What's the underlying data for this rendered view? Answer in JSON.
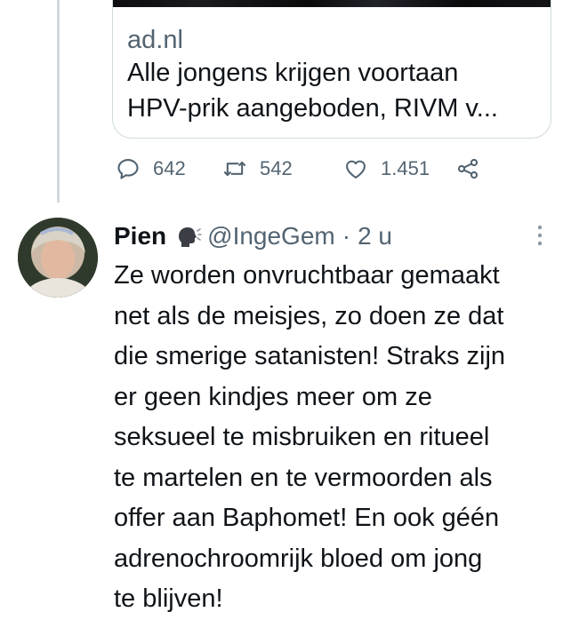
{
  "link_card": {
    "domain": "ad.nl",
    "title_lines": [
      "Alle jongens krijgen voortaan",
      "HPV-prik aangeboden, RIVM v..."
    ]
  },
  "actions": {
    "reply": {
      "icon": "reply-bubble-icon",
      "count": "642"
    },
    "retweet": {
      "icon": "retweet-icon",
      "count": "542"
    },
    "like": {
      "icon": "heart-icon",
      "count": "1.451"
    },
    "share": {
      "icon": "share-icon"
    }
  },
  "tweet": {
    "name": "Pien",
    "name_emoji": "speaking-head-icon",
    "handle": "@IngeGem",
    "separator": "·",
    "time": "2 u",
    "text_lines": [
      "Ze worden onvruchtbaar gemaakt",
      "net als de meisjes, zo doen ze dat",
      "die smerige satanisten! Straks zijn",
      "er geen kindjes meer om ze",
      "seksueel te misbruiken en ritueel",
      "te martelen en te vermoorden als",
      "offer aan Baphomet! En ook géén",
      "adrenochroomrijk bloed om jong",
      "te blijven!"
    ]
  },
  "colors": {
    "text_primary": "#0f1419",
    "text_secondary": "#536471",
    "border": "#cfd9de"
  }
}
